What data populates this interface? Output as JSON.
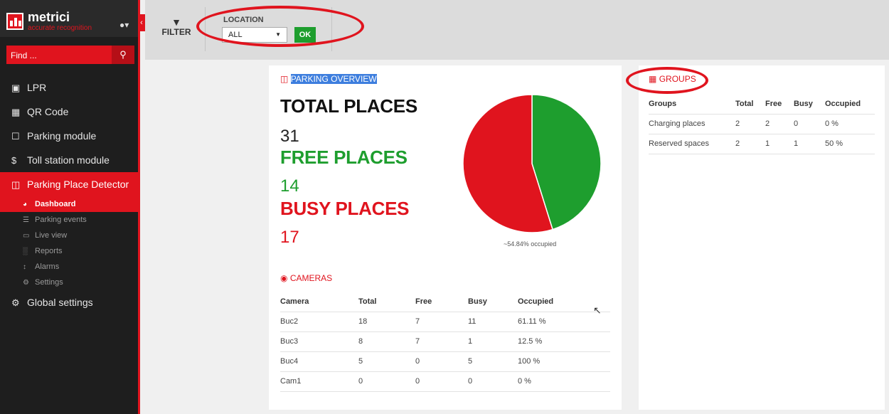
{
  "sidebar": {
    "logo_title": "metrici",
    "logo_subtitle": "accurate recognition",
    "user_icon": "user-icon",
    "search": {
      "placeholder": "Find ...",
      "icon": "search-icon"
    },
    "items": [
      {
        "label": "LPR",
        "icon": "video-icon"
      },
      {
        "label": "QR Code",
        "icon": "qr-icon"
      },
      {
        "label": "Parking module",
        "icon": "parking-p-icon"
      },
      {
        "label": "Toll station module",
        "icon": "dollar-icon"
      },
      {
        "label": "Parking Place Detector",
        "icon": "car-icon",
        "active": true
      },
      {
        "label": "Global settings",
        "icon": "gears-icon"
      }
    ],
    "subitems": [
      {
        "label": "Dashboard",
        "icon": "dashboard-icon",
        "active": true
      },
      {
        "label": "Parking events",
        "icon": "list-icon"
      },
      {
        "label": "Live view",
        "icon": "monitor-icon"
      },
      {
        "label": "Reports",
        "icon": "bar-chart-icon"
      },
      {
        "label": "Alarms",
        "icon": "arrows-icon"
      },
      {
        "label": "Settings",
        "icon": "gear-icon"
      }
    ]
  },
  "topbar": {
    "filter_label": "FILTER",
    "location_label": "LOCATION",
    "location_value": "ALL",
    "ok_label": "OK"
  },
  "overview": {
    "heading": "PARKING OVERVIEW",
    "total_label": "TOTAL PLACES",
    "total_value": "31",
    "free_label": "FREE PLACES",
    "free_value": "14",
    "busy_label": "BUSY PLACES",
    "busy_value": "17",
    "pie_caption": "~54.84% occupied"
  },
  "chart_data": {
    "type": "pie",
    "categories": [
      "Free",
      "Busy"
    ],
    "values": [
      14,
      17
    ],
    "colors": [
      "#1e9e2e",
      "#e0141e"
    ]
  },
  "cameras": {
    "heading": "CAMERAS",
    "columns": [
      "Camera",
      "Total",
      "Free",
      "Busy",
      "Occupied"
    ],
    "rows": [
      [
        "Buc2",
        "18",
        "7",
        "11",
        "61.11 %"
      ],
      [
        "Buc3",
        "8",
        "7",
        "1",
        "12.5 %"
      ],
      [
        "Buc4",
        "5",
        "0",
        "5",
        "100 %"
      ],
      [
        "Cam1",
        "0",
        "0",
        "0",
        "0 %"
      ]
    ]
  },
  "groups": {
    "heading": "GROUPS",
    "columns": [
      "Groups",
      "Total",
      "Free",
      "Busy",
      "Occupied"
    ],
    "rows": [
      [
        "Charging places",
        "2",
        "2",
        "0",
        "0 %"
      ],
      [
        "Reserved spaces",
        "2",
        "1",
        "1",
        "50 %"
      ]
    ]
  },
  "colors": {
    "accent": "#e0141e",
    "green": "#1e9e2e",
    "sidebar_bg": "#1e1e1e"
  }
}
